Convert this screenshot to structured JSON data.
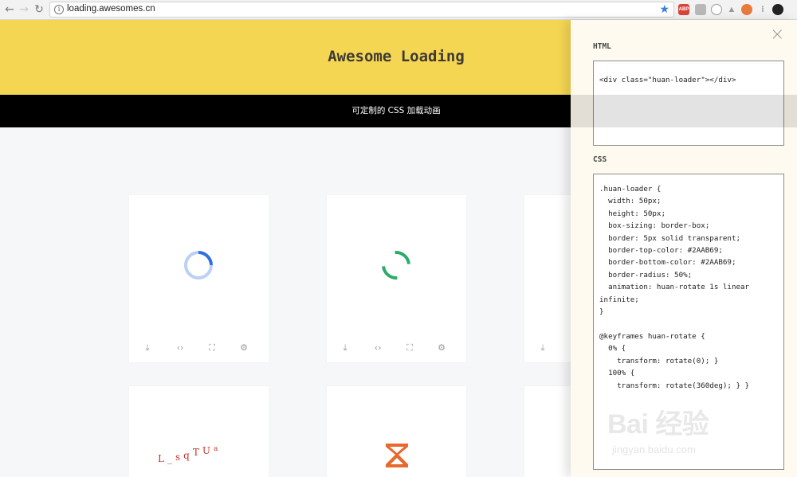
{
  "browser": {
    "url": "loading.awesomes.cn",
    "back_icon": "←",
    "forward_icon": "→",
    "reload_icon": "↻",
    "star_icon": "★",
    "extensions": [
      {
        "name": "adblock-plus-icon",
        "label": "ABP",
        "color": "#d9443a"
      },
      {
        "name": "extension-grey-icon",
        "label": "",
        "color": "#b8b8b8"
      },
      {
        "name": "extension-circle-icon",
        "label": "",
        "color": "#c9c9c9"
      },
      {
        "name": "extension-warning-icon",
        "label": "",
        "color": "#c3c3c3"
      },
      {
        "name": "extension-orange-icon",
        "label": "",
        "color": "#e87a3a"
      },
      {
        "name": "extension-dots-icon",
        "label": "",
        "color": "#a0a0a0"
      },
      {
        "name": "extension-dark-icon",
        "label": "",
        "color": "#222222"
      }
    ]
  },
  "hero": {
    "title": "Awesome Loading",
    "background": "#f5d653"
  },
  "subtitle": "可定制的 CSS 加载动画",
  "cards": {
    "tools": [
      "download-icon",
      "code-icon",
      "fullscreen-icon",
      "settings-icon"
    ],
    "tool_glyphs": [
      "⤓",
      "‹›",
      "⛶",
      "⚙"
    ],
    "bottom_row_text_loader": "L_sqTUa"
  },
  "panel": {
    "close_icon": "×",
    "html_label": "HTML",
    "html_code": "<div class=\"huan-loader\"></div>",
    "css_label": "CSS",
    "css_code": ".huan-loader {\n  width: 50px;\n  height: 50px;\n  box-sizing: border-box;\n  border: 5px solid transparent;\n  border-top-color: #2AAB69;\n  border-bottom-color: #2AAB69;\n  border-radius: 50%;\n  animation: huan-rotate 1s linear\ninfinite;\n}\n\n@keyframes huan-rotate {\n  0% {\n    transform: rotate(0); }\n  100% {\n    transform: rotate(360deg); } }"
  },
  "colors": {
    "blue_spinner": "#2f6fe0",
    "blue_track": "#bcd0f3",
    "green_spinner": "#2aab69",
    "orange_logo": "#e8692d",
    "text_loader": "#c0392b"
  },
  "watermark": {
    "main": "Bai 经验",
    "du": "du",
    "sub": "jingyan.baidu.com"
  }
}
